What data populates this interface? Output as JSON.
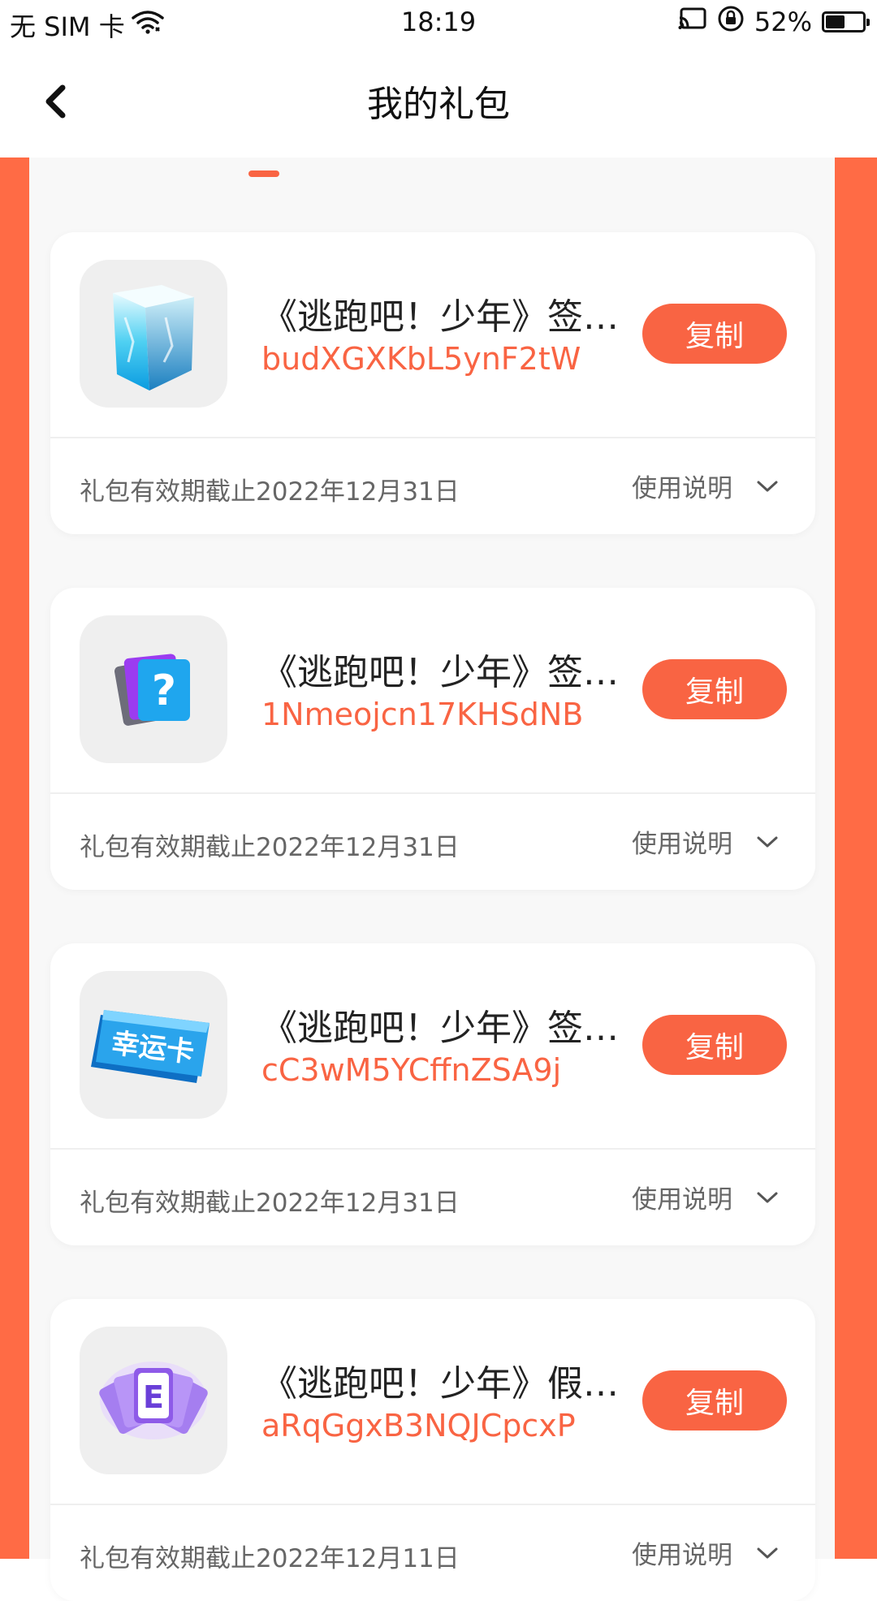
{
  "status_bar": {
    "carrier": "无 SIM 卡",
    "time": "18:19",
    "battery_text": "52%",
    "battery_level": 0.52
  },
  "nav": {
    "title": "我的礼包",
    "back_icon": "chevron-left-icon"
  },
  "colors": {
    "accent": "#F96443",
    "frame": "#FF6B45"
  },
  "cards": [
    {
      "title": "《逃跑吧！少年》签…",
      "code": "budXGXKbL5ynF2tW",
      "copy_label": "复制",
      "expiry": "礼包有效期截止2022年12月31日",
      "guide_label": "使用说明",
      "icon": "ice-cube-icon"
    },
    {
      "title": "《逃跑吧！少年》签…",
      "code": "1Nmeojcn17KHSdNB",
      "copy_label": "复制",
      "expiry": "礼包有效期截止2022年12月31日",
      "guide_label": "使用说明",
      "icon": "mystery-card-icon"
    },
    {
      "title": "《逃跑吧！少年》签…",
      "code": "cC3wM5YCffnZSA9j",
      "copy_label": "复制",
      "expiry": "礼包有效期截止2022年12月31日",
      "guide_label": "使用说明",
      "icon": "lucky-card-icon",
      "icon_text": "幸运卡"
    },
    {
      "title": "《逃跑吧！少年》假…",
      "code": "aRqGgxB3NQJCpcxP",
      "copy_label": "复制",
      "expiry": "礼包有效期截止2022年12月11日",
      "guide_label": "使用说明",
      "icon": "e-cards-icon"
    }
  ]
}
